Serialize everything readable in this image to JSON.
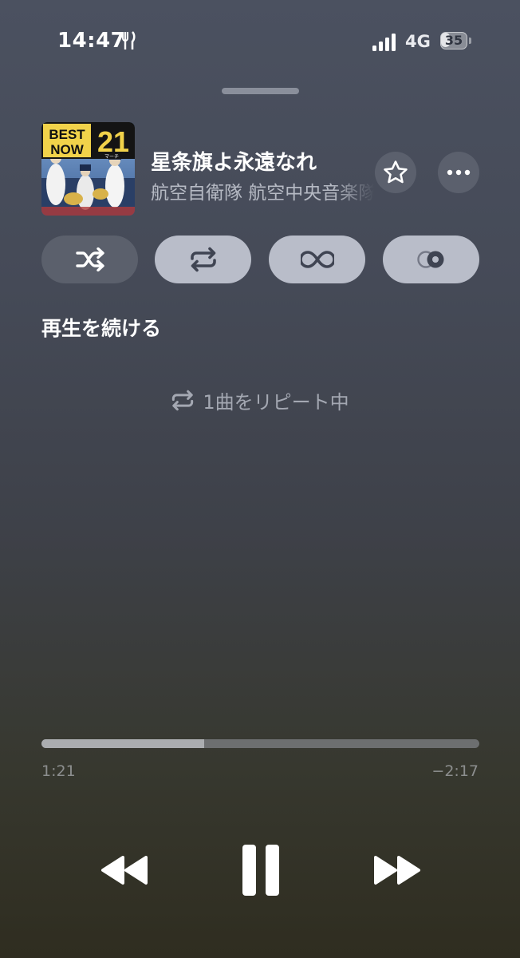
{
  "status_bar": {
    "time": "14:47",
    "network": "4G",
    "battery": "35",
    "battery_level": 0.35,
    "icons": [
      "fork-knife-icon",
      "signal-icon",
      "battery-icon"
    ]
  },
  "now_playing": {
    "album_art": {
      "top_text": "BEST",
      "middle_text": "NOW",
      "number": "21",
      "sub_text": "マーチ"
    },
    "title": "星条旗よ永遠なれ",
    "artist": "航空自衛隊 航空中央音楽隊",
    "favorite_icon": "star-outline-icon",
    "more_icon": "ellipsis-icon"
  },
  "modes": [
    {
      "name": "shuffle",
      "icon": "shuffle-icon",
      "active": false
    },
    {
      "name": "repeat",
      "icon": "repeat-icon",
      "active": true
    },
    {
      "name": "autoplay",
      "icon": "infinity-icon",
      "active": true
    },
    {
      "name": "crossfade",
      "icon": "crossfade-icon",
      "active": true
    }
  ],
  "queue": {
    "heading": "再生を続ける",
    "repeat_status": "1曲をリピート中"
  },
  "progress": {
    "elapsed": "1:21",
    "remaining": "−2:17",
    "fraction": 0.372
  },
  "transport": {
    "rewind_icon": "rewind-icon",
    "pause_icon": "pause-icon",
    "forward_icon": "fast-forward-icon"
  },
  "colors": {
    "active_button": "#b9bdc9",
    "inactive_button": "#5b606c",
    "secondary_text": "#b6bac4"
  }
}
